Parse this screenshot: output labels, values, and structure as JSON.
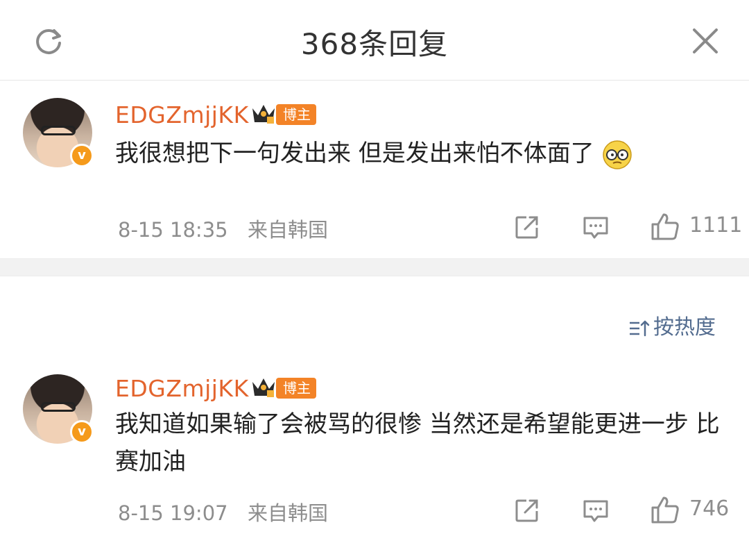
{
  "header": {
    "title": "368条回复"
  },
  "comments": [
    {
      "username": "EDGZmjjKK",
      "badge": "博主",
      "text": "我很想把下一句发出来 但是发出来怕不体面了",
      "emoji": "doge-glasses-emoji",
      "time": "8-15 18:35",
      "location": "来自韩国",
      "likes": "1111"
    },
    {
      "username": "EDGZmjjKK",
      "badge": "博主",
      "text": "我知道如果输了会被骂的很惨 当然还是希望能更进一步 比赛加油",
      "time": "8-15 19:07",
      "location": "来自韩国",
      "likes": "746"
    }
  ],
  "sort": {
    "label": "按热度"
  },
  "colors": {
    "username": "#e3642d",
    "badge_bg": "#f38327",
    "sort_link": "#536c8f",
    "meta_gray": "#8d8d8d"
  }
}
